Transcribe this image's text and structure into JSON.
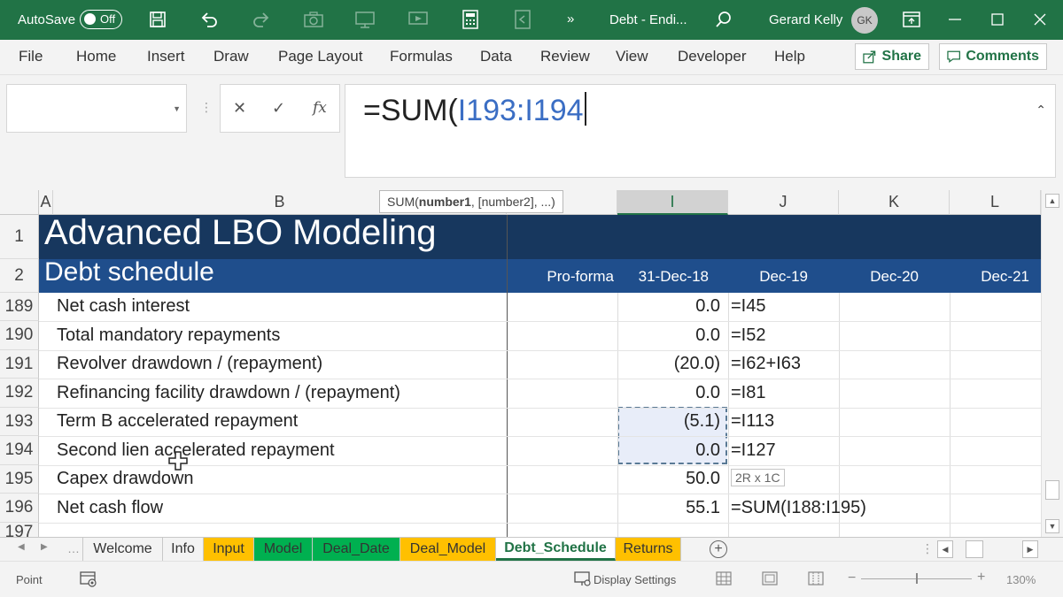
{
  "titlebar": {
    "autosave_label": "AutoSave",
    "autosave_state": "Off",
    "doc_title": "Debt - Endi...",
    "user_name": "Gerard Kelly",
    "user_initials": "GK",
    "overflow_glyph": "»",
    "icons": [
      "save-icon",
      "undo-icon",
      "redo-icon",
      "camera-icon",
      "presentation-icon",
      "screen-share-icon",
      "calculator-icon",
      "file-export-icon",
      "search-icon",
      "ribbon-display-icon",
      "minimize-icon",
      "maximize-icon",
      "close-icon"
    ],
    "accent_color": "#217346"
  },
  "ribbon": {
    "tabs": [
      "File",
      "Home",
      "Insert",
      "Draw",
      "Page Layout",
      "Formulas",
      "Data",
      "Review",
      "View",
      "Developer",
      "Help"
    ],
    "share_label": "Share",
    "comments_label": "Comments"
  },
  "formula_bar": {
    "name_box": "",
    "cancel_glyph": "✕",
    "enter_glyph": "✓",
    "fx_label": "fx",
    "formula_prefix": "=SUM(",
    "formula_ref": "I193:I194"
  },
  "grid": {
    "tooltip_fn": "SUM(",
    "tooltip_arg1": "number1",
    "tooltip_rest": ", [number2], ...)",
    "columns": [
      "A",
      "B",
      "I",
      "J",
      "K",
      "L"
    ],
    "title_row": {
      "num": "1",
      "text": "Advanced LBO Modeling"
    },
    "subtitle_row": {
      "num": "2",
      "text": "Debt schedule",
      "headers": [
        "Pro-forma",
        "31-Dec-18",
        "Dec-19",
        "Dec-20",
        "Dec-21"
      ]
    },
    "rows": [
      {
        "num": "189",
        "label": "Net cash interest",
        "i": "0.0",
        "j": "=I45"
      },
      {
        "num": "190",
        "label": "Total mandatory repayments",
        "i": "0.0",
        "j": "=I52"
      },
      {
        "num": "191",
        "label": "Revolver drawdown / (repayment)",
        "i": "(20.0)",
        "j": "=I62+I63"
      },
      {
        "num": "192",
        "label": "Refinancing facility drawdown / (repayment)",
        "i": "0.0",
        "j": "=I81"
      },
      {
        "num": "193",
        "label": "Term B accelerated repayment",
        "i": "(5.1)",
        "j": "=I113"
      },
      {
        "num": "194",
        "label": "Second lien accelerated repayment",
        "i": "0.0",
        "j": "=I127"
      },
      {
        "num": "195",
        "label": "Capex drawdown",
        "i": "50.0",
        "j": ""
      },
      {
        "num": "196",
        "label": "Net cash flow",
        "i": "55.1",
        "j": "=SUM(I188:I195)"
      },
      {
        "num": "197",
        "label": "",
        "i": "",
        "j": ""
      }
    ],
    "selection_hint": "2R x 1C",
    "band_dark": "#17375e",
    "band_blue": "#1f4e8c"
  },
  "sheet_tabs": {
    "tabs": [
      {
        "name": "Welcome",
        "color": ""
      },
      {
        "name": "Info",
        "color": ""
      },
      {
        "name": "Input",
        "color": "#ffc000"
      },
      {
        "name": "Model",
        "color": "#00b050"
      },
      {
        "name": "Deal_Date",
        "color": "#00b050"
      },
      {
        "name": "Deal_Model",
        "color": "#ffc000"
      },
      {
        "name": "Debt_Schedule",
        "color": "",
        "active": true
      },
      {
        "name": "Returns",
        "color": "#ffc000"
      }
    ]
  },
  "status_bar": {
    "mode": "Point",
    "display_settings": "Display Settings",
    "zoom_minus": "−",
    "zoom_plus": "+",
    "zoom": "130%"
  }
}
